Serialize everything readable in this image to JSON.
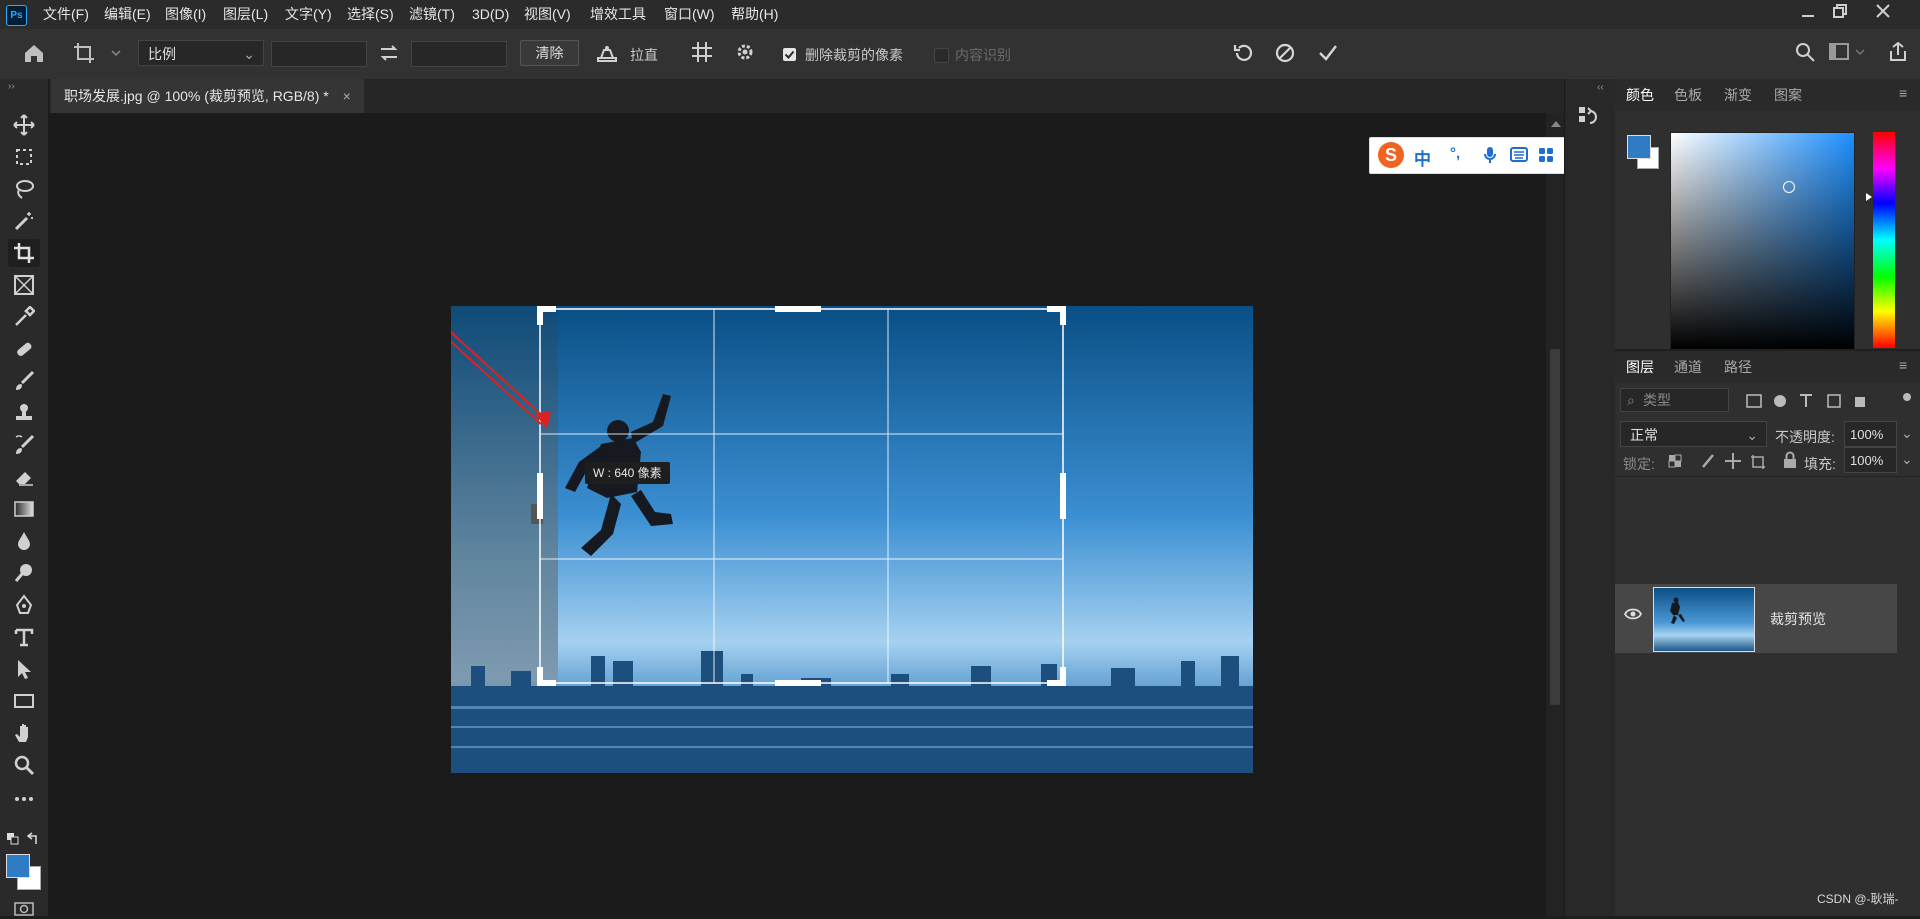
{
  "menubar": {
    "app_icon": "Ps",
    "items": [
      "文件(F)",
      "编辑(E)",
      "图像(I)",
      "图层(L)",
      "文字(Y)",
      "选择(S)",
      "滤镜(T)",
      "3D(D)",
      "视图(V)",
      "增效工具",
      "窗口(W)",
      "帮助(H)"
    ],
    "window_controls": [
      "minimize-icon",
      "restore-icon",
      "close-icon"
    ]
  },
  "options": {
    "ratio_select": "比例",
    "ratio_width": "",
    "ratio_height": "",
    "clear_label": "清除",
    "straighten_label": "拉直",
    "delete_cropped_label": "删除裁剪的像素",
    "delete_cropped_checked": true,
    "content_aware_label": "内容识别",
    "content_aware_checked": false
  },
  "document": {
    "tab_title": "职场发展.jpg @ 100% (裁剪预览, RGB/8) *",
    "crop_tooltip": "W : 640 像素"
  },
  "ime": {
    "mode": "中",
    "punct": "°,"
  },
  "color_panel": {
    "tabs": [
      "颜色",
      "色板",
      "渐变",
      "图案"
    ],
    "foreground": "#2f7bc4",
    "background": "#ffffff",
    "picker_hue": "#1e90ff"
  },
  "layers_panel": {
    "tabs": [
      "图层",
      "通道",
      "路径"
    ],
    "filter_placeholder": "类型",
    "blend_mode": "正常",
    "opacity_label": "不透明度:",
    "opacity_value": "100%",
    "lock_label": "锁定:",
    "fill_label": "填充:",
    "fill_value": "100%",
    "layers": [
      {
        "name": "裁剪预览",
        "visible": true,
        "selected": true
      }
    ]
  },
  "watermark": "CSDN @-耿瑞-",
  "colors": {
    "accent_arrow": "#e02020",
    "app_bg": "#1e1e1e",
    "panel_bg": "#2f2f2f",
    "crop_border": "#ffffff"
  }
}
